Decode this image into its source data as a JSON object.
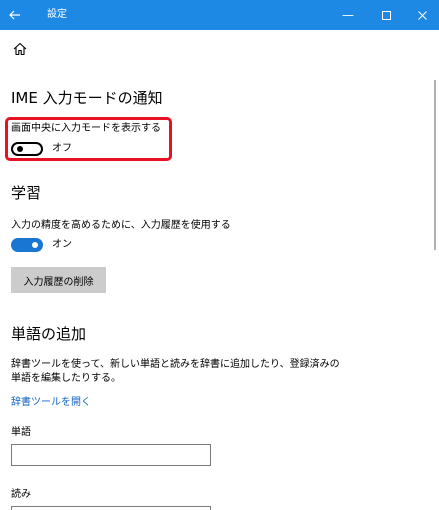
{
  "window": {
    "title": "設定",
    "back_icon": "back-arrow-icon",
    "minimize_glyph": "—",
    "maximize_glyph": "☐",
    "close_glyph": "✕",
    "accent_color": "#1e88e5"
  },
  "home": {
    "icon": "home-icon"
  },
  "ime_notification": {
    "title": "IME 入力モードの通知",
    "setting_label": "画面中央に入力モードを表示する",
    "toggle_state": "off",
    "toggle_text": "オフ",
    "highlight_color": "#e81123"
  },
  "learning": {
    "title": "学習",
    "setting_label": "入力の精度を高めるために、入力履歴を使用する",
    "toggle_state": "on",
    "toggle_text": "オン",
    "delete_button": "入力履歴の削除"
  },
  "add_word": {
    "title": "単語の追加",
    "description": "辞書ツールを使って、新しい単語と読みを辞書に追加したり、登録済みの単語を編集したりする。",
    "link": "辞書ツールを開く",
    "word_label": "単語",
    "word_value": "",
    "reading_label": "読み",
    "reading_value": ""
  }
}
